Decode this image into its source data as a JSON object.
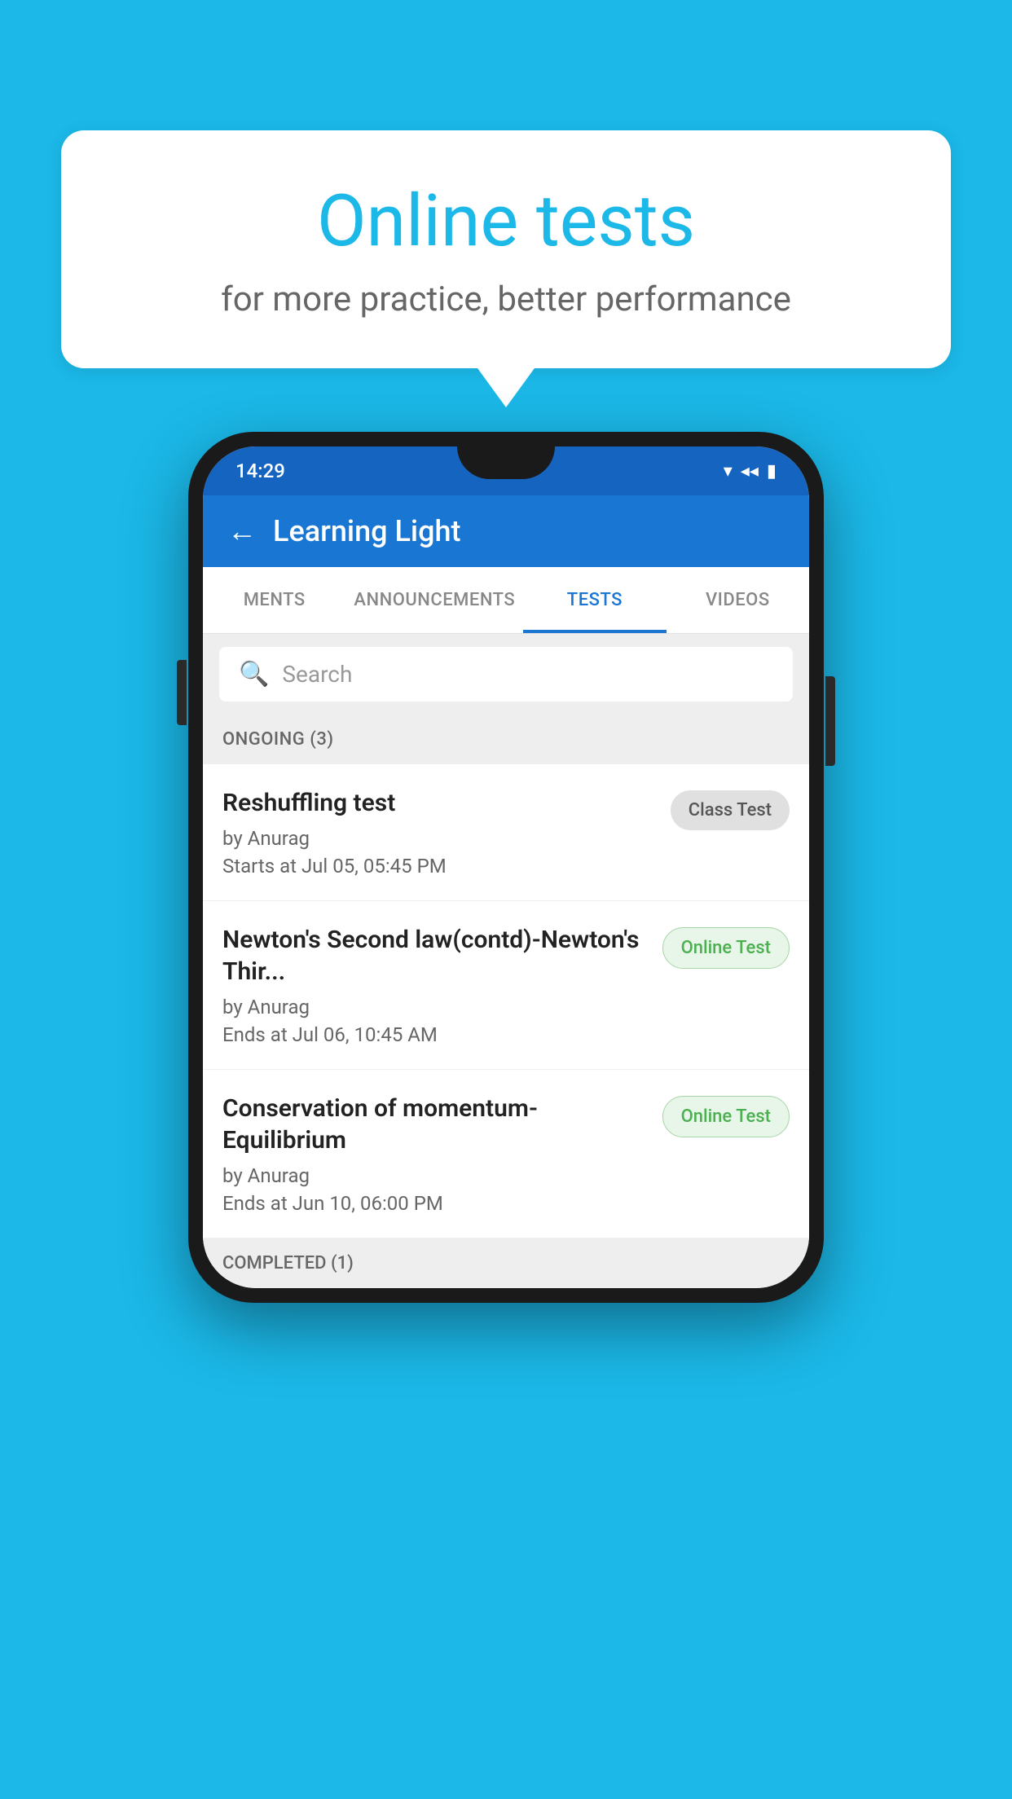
{
  "background_color": "#1bb8e8",
  "speech_bubble": {
    "title": "Online tests",
    "subtitle": "for more practice, better performance"
  },
  "phone": {
    "status_bar": {
      "time": "14:29",
      "icons": [
        "wifi",
        "signal",
        "battery"
      ]
    },
    "app_bar": {
      "title": "Learning Light",
      "back_label": "←"
    },
    "tabs": [
      {
        "label": "MENTS",
        "active": false
      },
      {
        "label": "ANNOUNCEMENTS",
        "active": false
      },
      {
        "label": "TESTS",
        "active": true
      },
      {
        "label": "VIDEOS",
        "active": false
      }
    ],
    "search": {
      "placeholder": "Search"
    },
    "ongoing_section": {
      "header": "ONGOING (3)",
      "tests": [
        {
          "name": "Reshuffling test",
          "author": "by Anurag",
          "time_label": "Starts at",
          "time": "Jul 05, 05:45 PM",
          "badge": "Class Test",
          "badge_type": "class"
        },
        {
          "name": "Newton's Second law(contd)-Newton's Thir...",
          "author": "by Anurag",
          "time_label": "Ends at",
          "time": "Jul 06, 10:45 AM",
          "badge": "Online Test",
          "badge_type": "online"
        },
        {
          "name": "Conservation of momentum-Equilibrium",
          "author": "by Anurag",
          "time_label": "Ends at",
          "time": "Jun 10, 06:00 PM",
          "badge": "Online Test",
          "badge_type": "online"
        }
      ]
    },
    "completed_section": {
      "header": "COMPLETED (1)"
    }
  }
}
